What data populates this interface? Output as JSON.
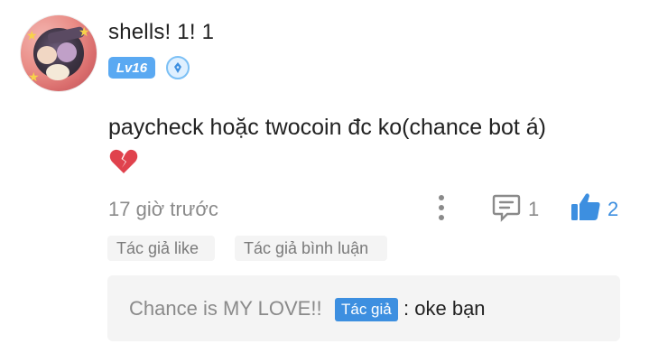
{
  "comment": {
    "username": "shells! 1! 1",
    "level": "Lv16",
    "text": "paycheck hoặc twocoin đc ko(chance bot á)",
    "timestamp": "17 giờ trước",
    "reply_count": "1",
    "like_count": "2"
  },
  "tags": {
    "author_like": "Tác giả like",
    "author_comment": "Tác giả bình luận"
  },
  "reply": {
    "author": "Chance is MY LOVE!!",
    "author_chip": "Tác giả",
    "separator": ":",
    "text": "oke bạn"
  },
  "colors": {
    "accent": "#3d8fe0",
    "level_badge": "#5aa9f2",
    "muted_text": "#8a8a8a",
    "heart": "#e0424d"
  }
}
